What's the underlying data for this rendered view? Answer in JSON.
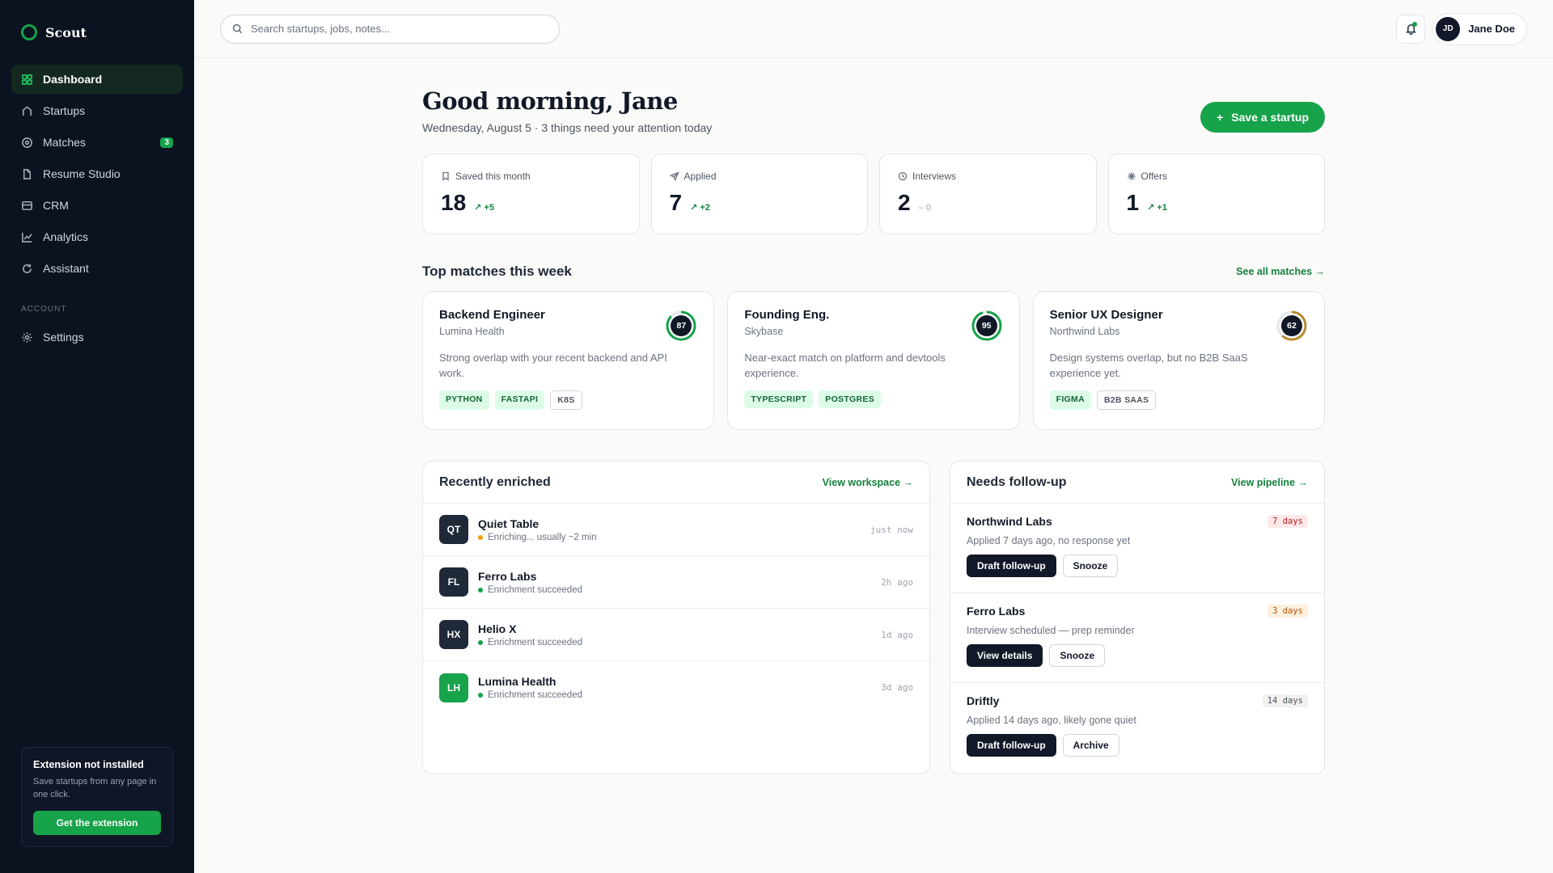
{
  "brand": {
    "name": "Scout"
  },
  "nav": {
    "items": [
      {
        "label": "Dashboard",
        "icon": "grid-icon"
      },
      {
        "label": "Startups",
        "icon": "home-icon"
      },
      {
        "label": "Matches",
        "icon": "target-icon",
        "badge": "3"
      },
      {
        "label": "Resume Studio",
        "icon": "document-icon"
      },
      {
        "label": "CRM",
        "icon": "inbox-icon"
      },
      {
        "label": "Analytics",
        "icon": "chart-icon"
      },
      {
        "label": "Assistant",
        "icon": "refresh-icon"
      }
    ],
    "section_label": "ACCOUNT",
    "settings_label": "Settings"
  },
  "extension": {
    "title": "Extension not installed",
    "desc": "Save startups from any page in one click.",
    "button": "Get the extension"
  },
  "topbar": {
    "search_placeholder": "Search startups, jobs, notes...",
    "user_initials": "JD",
    "user_name": "Jane Doe"
  },
  "greeting": {
    "title": "Good morning, Jane",
    "subtitle": "Wednesday, August 5 · 3 things need your attention today",
    "save_button": "Save a startup"
  },
  "stats": [
    {
      "label": "Saved this month",
      "value": "18",
      "delta": "↗ +5",
      "icon": "bookmark-icon"
    },
    {
      "label": "Applied",
      "value": "7",
      "delta": "↗ +2",
      "icon": "send-icon"
    },
    {
      "label": "Interviews",
      "value": "2",
      "delta": "– 0",
      "icon": "clock-icon"
    },
    {
      "label": "Offers",
      "value": "1",
      "delta": "↗ +1",
      "icon": "sparkle-icon"
    }
  ],
  "matches": {
    "title": "Top matches this week",
    "link": "See all matches →",
    "cards": [
      {
        "title": "Backend Engineer",
        "company": "Lumina Health",
        "score": 87,
        "desc": "Strong overlap with your recent backend and API work.",
        "tags": [
          {
            "label": "PYTHON"
          },
          {
            "label": "FASTAPI"
          },
          {
            "label": "K8S"
          }
        ],
        "ring_color": "#16a34a"
      },
      {
        "title": "Founding Eng.",
        "company": "Skybase",
        "score": 95,
        "desc": "Near-exact match on platform and devtools experience.",
        "tags": [
          {
            "label": "TYPESCRIPT"
          },
          {
            "label": "POSTGRES"
          }
        ],
        "ring_color": "#16a34a"
      },
      {
        "title": "Senior UX Designer",
        "company": "Northwind Labs",
        "score": 62,
        "desc": "Design systems overlap, but no B2B SaaS experience yet.",
        "tags": [
          {
            "label": "FIGMA"
          },
          {
            "label": "B2B SAAS"
          }
        ],
        "ring_color": "#b98a2e"
      }
    ]
  },
  "enriched": {
    "title": "Recently enriched",
    "link": "View workspace →",
    "rows": [
      {
        "initials": "QT",
        "name": "Quiet Table",
        "status": "Enriching... usually ~2 min",
        "time": "just now"
      },
      {
        "initials": "FL",
        "name": "Ferro Labs",
        "status": "Enrichment succeeded",
        "time": "2h ago"
      },
      {
        "initials": "HX",
        "name": "Helio X",
        "status": "Enrichment succeeded",
        "time": "1d ago"
      },
      {
        "initials": "LH",
        "name": "Lumina Health",
        "status": "Enrichment succeeded",
        "time": "3d ago"
      }
    ]
  },
  "followup": {
    "title": "Needs follow-up",
    "link": "View pipeline →",
    "items": [
      {
        "name": "Northwind Labs",
        "badge": "7 days",
        "desc": "Applied 7 days ago, no response yet",
        "primary": "Draft follow-up",
        "secondary": "Snooze"
      },
      {
        "name": "Ferro Labs",
        "badge": "3 days",
        "desc": "Interview scheduled — prep reminder",
        "primary": "View details",
        "secondary": "Snooze"
      },
      {
        "name": "Driftly",
        "badge": "14 days",
        "desc": "Applied 14 days ago, likely gone quiet",
        "primary": "Draft follow-up",
        "secondary": "Archive"
      }
    ]
  }
}
